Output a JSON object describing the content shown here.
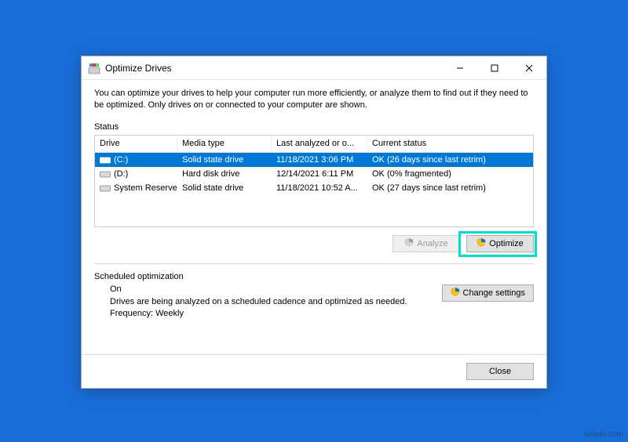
{
  "window": {
    "title": "Optimize Drives",
    "description": "You can optimize your drives to help your computer run more efficiently, or analyze them to find out if they need to be optimized. Only drives on or connected to your computer are shown."
  },
  "status": {
    "label": "Status",
    "columns": {
      "drive": "Drive",
      "media": "Media type",
      "last": "Last analyzed or o...",
      "status": "Current status"
    },
    "rows": [
      {
        "drive": "(C:)",
        "media": "Solid state drive",
        "last": "11/18/2021 3:06 PM",
        "status": "OK (26 days since last retrim)",
        "selected": true,
        "iconFill": "#ffffff",
        "iconStroke": "#ffffff"
      },
      {
        "drive": "(D:)",
        "media": "Hard disk drive",
        "last": "12/14/2021 6:11 PM",
        "status": "OK (0% fragmented)",
        "selected": false,
        "iconFill": "#d8d8d8",
        "iconStroke": "#888"
      },
      {
        "drive": "System Reserved",
        "media": "Solid state drive",
        "last": "11/18/2021 10:52 A...",
        "status": "OK (27 days since last retrim)",
        "selected": false,
        "iconFill": "#d8d8d8",
        "iconStroke": "#888"
      }
    ]
  },
  "buttons": {
    "analyze": "Analyze",
    "optimize": "Optimize",
    "change_settings": "Change settings",
    "close": "Close"
  },
  "scheduled": {
    "label": "Scheduled optimization",
    "state": "On",
    "desc": "Drives are being analyzed on a scheduled cadence and optimized as needed.",
    "freq": "Frequency: Weekly"
  },
  "watermark": "wsxdn.com"
}
